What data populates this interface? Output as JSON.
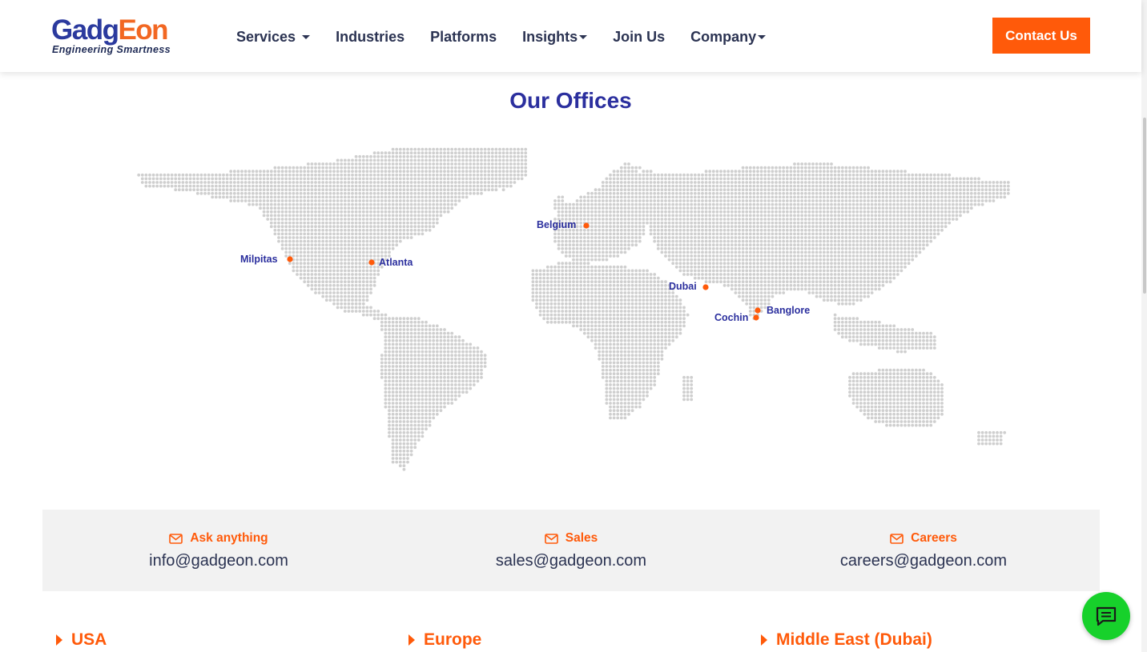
{
  "brand": {
    "logo_part1": "Gadg",
    "logo_part2": "Eon",
    "tagline": "Engineering Smartness",
    "primary_color": "#2b2f9e",
    "accent_color": "#ff5a0a"
  },
  "nav": {
    "items": [
      {
        "label": "Services",
        "has_dropdown": true
      },
      {
        "label": "Industries",
        "has_dropdown": false
      },
      {
        "label": "Platforms",
        "has_dropdown": false
      },
      {
        "label": "Insights",
        "has_dropdown": true
      },
      {
        "label": "Join Us",
        "has_dropdown": false
      },
      {
        "label": "Company",
        "has_dropdown": true
      }
    ],
    "cta_label": "Contact Us"
  },
  "offices": {
    "title": "Our Offices",
    "cities": [
      "Milpitas",
      "Atlanta",
      "Belgium",
      "Dubai",
      "Banglore",
      "Cochin"
    ]
  },
  "contacts": [
    {
      "label": "Ask anything",
      "email": "info@gadgeon.com",
      "icon": "envelope-icon"
    },
    {
      "label": "Sales",
      "email": "sales@gadgeon.com",
      "icon": "envelope-icon"
    },
    {
      "label": "Careers",
      "email": "careers@gadgeon.com",
      "icon": "envelope-icon"
    }
  ],
  "regions": [
    "USA",
    "Europe",
    "Middle East (Dubai)"
  ],
  "chat": {
    "icon": "chat-icon",
    "color": "#17d12b"
  }
}
